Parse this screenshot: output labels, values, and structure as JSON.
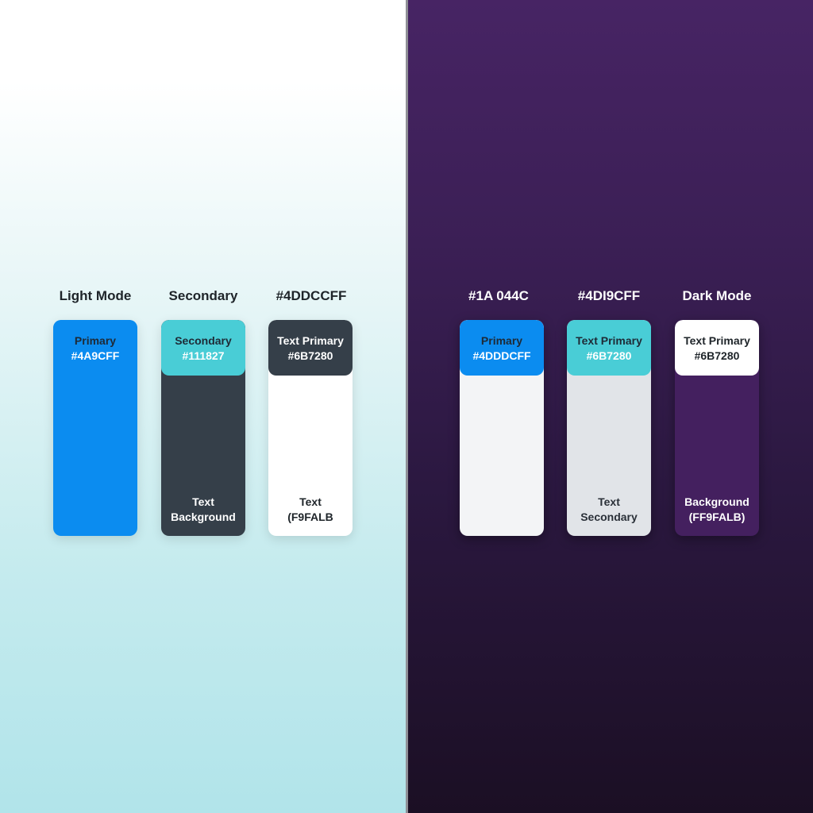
{
  "light_panel": {
    "headers": [
      "Light Mode",
      "Secondary",
      "#4DDCCFF"
    ],
    "swatches": [
      {
        "top_line1": "Primary",
        "top_line2": "#4A9CFF",
        "bottom_line1": "",
        "bottom_line2": "",
        "top_color": "#0b8cf0",
        "body_color": "#0b8cf0",
        "top_text_color": "#1e2a36",
        "top_text2_color": "#ffffff",
        "bottom_text_color": "#ffffff"
      },
      {
        "top_line1": "Secondary",
        "top_line2": "#111827",
        "bottom_line1": "Text",
        "bottom_line2": "Background",
        "top_color": "#49cdd6",
        "body_color": "#353f49",
        "top_text_color": "#1e2a36",
        "top_text2_color": "#ffffff",
        "bottom_text_color": "#ffffff"
      },
      {
        "top_line1": "Text Primary",
        "top_line2": "#6B7280",
        "bottom_line1": "Text",
        "bottom_line2": "(F9FALB",
        "top_color": "#353f49",
        "body_color": "#ffffff",
        "top_text_color": "#ffffff",
        "top_text2_color": "#ffffff",
        "bottom_text_color": "#1e2429"
      }
    ]
  },
  "dark_panel": {
    "headers": [
      "#1A 044C",
      "#4DI9CFF",
      "Dark Mode"
    ],
    "swatches": [
      {
        "top_line1": "Primary",
        "top_line2": "#4DDDCFF",
        "bottom_line1": "",
        "bottom_line2": "",
        "top_color": "#0b8cf0",
        "body_color": "#f3f4f6",
        "top_text_color": "#1e2a36",
        "top_text2_color": "#ffffff",
        "bottom_text_color": "#1e2429"
      },
      {
        "top_line1": "Text Primary",
        "top_line2": "#6B7280",
        "bottom_line1": "Text",
        "bottom_line2": "Secondary",
        "top_color": "#49cdd6",
        "body_color": "#e1e4e8",
        "top_text_color": "#1e2a36",
        "top_text2_color": "#ffffff",
        "bottom_text_color": "#2a3038"
      },
      {
        "top_line1": "Text Primary",
        "top_line2": "#6B7280",
        "bottom_line1": "Background",
        "bottom_line2": "(FF9FALB)",
        "top_color": "#ffffff",
        "body_color": "#44205f",
        "top_text_color": "#1e2429",
        "top_text2_color": "#1e2429",
        "bottom_text_color": "#ffffff"
      }
    ]
  }
}
